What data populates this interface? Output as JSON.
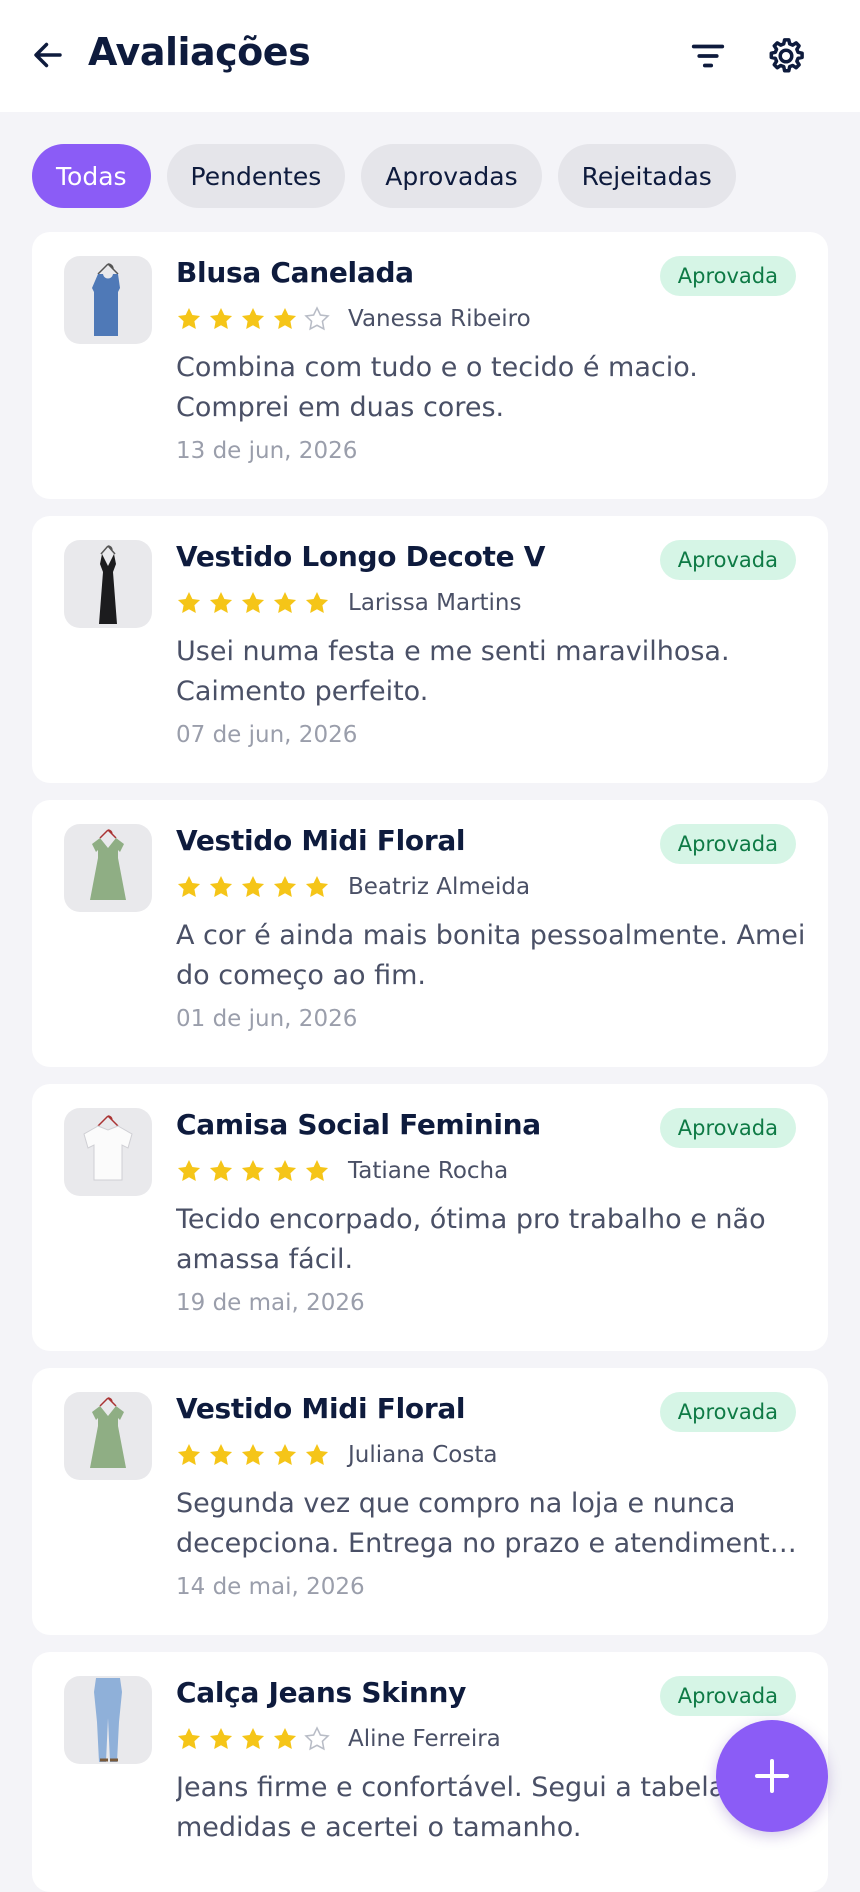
{
  "header": {
    "title": "Avaliações"
  },
  "filters": [
    {
      "label": "Todas",
      "active": true
    },
    {
      "label": "Pendentes",
      "active": false
    },
    {
      "label": "Aprovadas",
      "active": false
    },
    {
      "label": "Rejeitadas",
      "active": false
    }
  ],
  "colors": {
    "accent": "#8b5cf6",
    "star": "#f5c518",
    "badge_bg": "#d6f5e6",
    "badge_text": "#0e7a45"
  },
  "reviews": [
    {
      "product": "Blusa Canelada",
      "status": "Aprovada",
      "rating": 4,
      "reviewer": "Vanessa Ribeiro",
      "text": "Combina com tudo e o tecido é macio. Comprei em duas cores.",
      "date": "13 de jun, 2026",
      "thumb_icon": "blue-tank-top-icon"
    },
    {
      "product": "Vestido Longo Decote V",
      "status": "Aprovada",
      "rating": 5,
      "reviewer": "Larissa Martins",
      "text": "Usei numa festa e me senti maravilhosa. Caimento perfeito.",
      "date": "07 de jun, 2026",
      "thumb_icon": "black-long-dress-icon"
    },
    {
      "product": "Vestido Midi Floral",
      "status": "Aprovada",
      "rating": 5,
      "reviewer": "Beatriz Almeida",
      "text": "A cor é ainda mais bonita pessoalmente. Amei do começo ao fim.",
      "date": "01 de jun, 2026",
      "thumb_icon": "green-floral-dress-icon"
    },
    {
      "product": "Camisa Social Feminina",
      "status": "Aprovada",
      "rating": 5,
      "reviewer": "Tatiane Rocha",
      "text": "Tecido encorpado, ótima pro trabalho e não amassa fácil.",
      "date": "19 de mai, 2026",
      "thumb_icon": "white-shirt-icon"
    },
    {
      "product": "Vestido Midi Floral",
      "status": "Aprovada",
      "rating": 5,
      "reviewer": "Juliana Costa",
      "text": "Segunda vez que compro na loja e nunca decepciona. Entrega no prazo e atendimento excelente.",
      "date": "14 de mai, 2026",
      "thumb_icon": "green-floral-dress-icon"
    },
    {
      "product": "Calça Jeans Skinny",
      "status": "Aprovada",
      "rating": 4,
      "reviewer": "Aline Ferreira",
      "text": "Jeans firme e confortável. Segui a tabela de medidas e acertei o tamanho.",
      "date": "",
      "thumb_icon": "blue-jeans-icon"
    }
  ]
}
